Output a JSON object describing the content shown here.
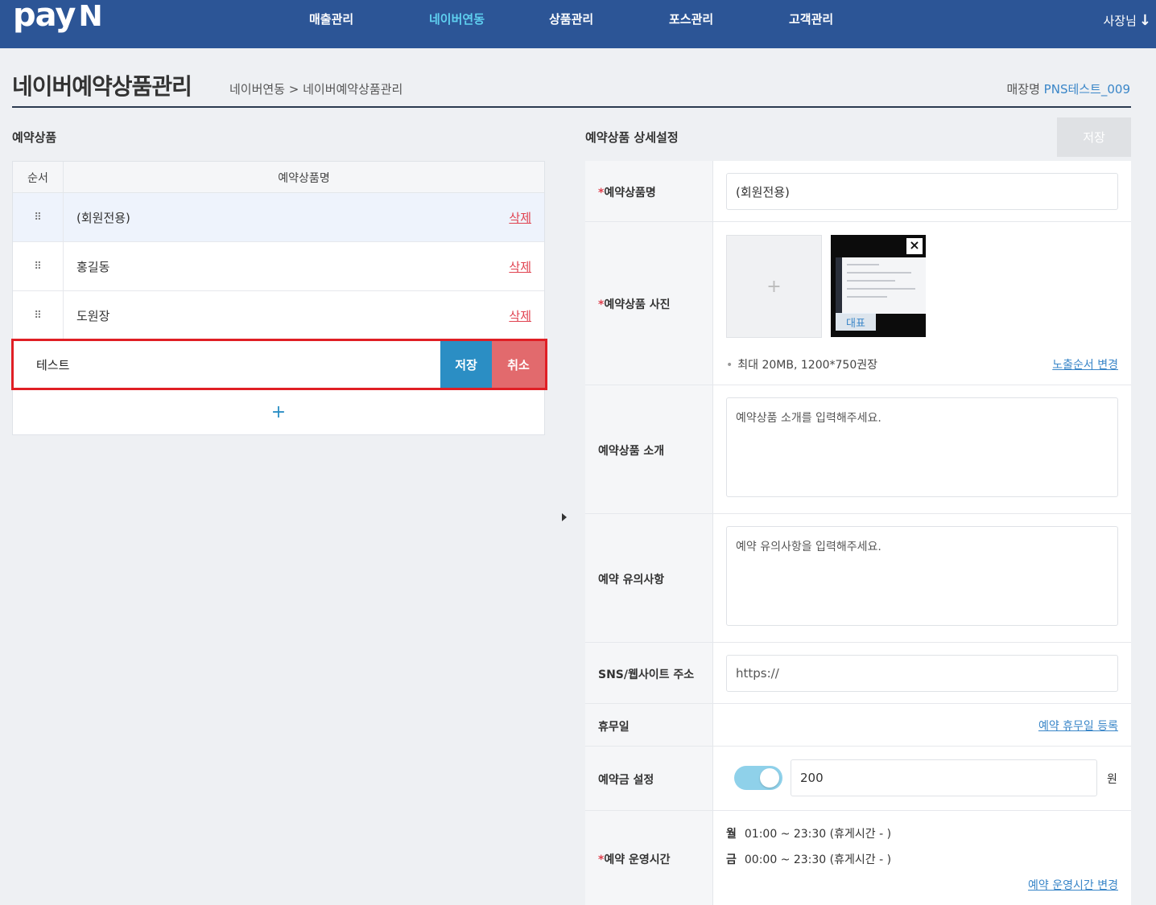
{
  "header": {
    "logo_main": "pay",
    "logo_n": "N",
    "nav": [
      "매출관리",
      "네이버연동",
      "상품관리",
      "포스관리",
      "고객관리"
    ],
    "active_nav": "네이버연동",
    "user": "사장님",
    "user_arrow": "↓"
  },
  "page": {
    "title": "네이버예약상품관리",
    "breadcrumb": "네이버연동 > 네이버예약상품관리",
    "store_label": "매장명",
    "store_value": "PNS테스트_009"
  },
  "left": {
    "section_title": "예약상품",
    "col_order": "순서",
    "col_name": "예약상품명",
    "handle_glyph": "⠿",
    "rows": [
      {
        "name": "(회원전용)",
        "delete": "삭제"
      },
      {
        "name": "홍길동",
        "delete": "삭제"
      },
      {
        "name": "도원장",
        "delete": "삭제"
      }
    ],
    "edit": {
      "value": "테스트",
      "save": "저장",
      "cancel": "취소"
    },
    "add": "+"
  },
  "right": {
    "section_title": "예약상품 상세설정",
    "save_button": "저장",
    "product_name": {
      "label": "예약상품명",
      "value": "(회원전용)"
    },
    "photo": {
      "label": "예약상품 사진",
      "add": "+",
      "representative": "대표",
      "close": "×",
      "note": "최대 20MB, 1200*750권장",
      "link": "노출순서 변경"
    },
    "intro": {
      "label": "예약상품 소개",
      "placeholder": "예약상품 소개를 입력해주세요."
    },
    "notice": {
      "label": "예약 유의사항",
      "placeholder": "예약 유의사항을 입력해주세요."
    },
    "sns": {
      "label": "SNS/웹사이트 주소",
      "placeholder": "https://"
    },
    "holiday": {
      "label": "휴무일",
      "link": "예약 휴무일 등록"
    },
    "deposit": {
      "label": "예약금 설정",
      "enabled": true,
      "value": "200",
      "unit": "원"
    },
    "hours": {
      "label": "예약 운영시간",
      "lines": [
        {
          "day": "월",
          "time": "01:00 ~ 23:30 (휴게시간 - )"
        },
        {
          "day": "금",
          "time": "00:00 ~ 23:30 (휴게시간 - )"
        }
      ],
      "link": "예약 운영시간 변경"
    }
  },
  "colors": {
    "header_bg": "#2c5596",
    "active_nav": "#5fd0f0",
    "save": "#2b8ec4",
    "cancel": "#e26a6d",
    "highlight_border": "#e01f25",
    "link": "#3a86c8",
    "toggle_on": "#8fd1ea"
  }
}
